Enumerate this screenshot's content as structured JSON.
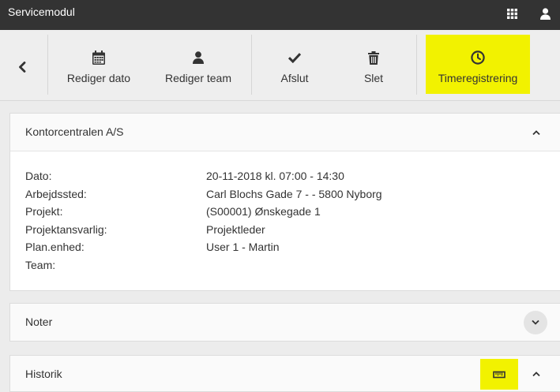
{
  "app": {
    "title": "Servicemodul",
    "apps_icon": "grid-icon",
    "user_icon": "user-icon"
  },
  "toolbar": {
    "back_icon": "chevron-left-icon",
    "actions": [
      {
        "label": "Rediger dato",
        "icon": "calendar-icon"
      },
      {
        "label": "Rediger team",
        "icon": "user-icon"
      },
      {
        "label": "Afslut",
        "icon": "check-icon"
      },
      {
        "label": "Slet",
        "icon": "trash-icon"
      },
      {
        "label": "Timeregistrering",
        "icon": "clock-icon",
        "highlighted": true
      }
    ]
  },
  "details_panel": {
    "title": "Kontorcentralen A/S",
    "expanded": true,
    "toggle_icon": "chevron-up-icon",
    "rows": [
      {
        "label": "Dato:",
        "value": "20-11-2018 kl. 07:00 - 14:30"
      },
      {
        "label": "Arbejdssted:",
        "value": "Carl Blochs Gade 7 - - 5800 Nyborg"
      },
      {
        "label": "Projekt:",
        "value": "(S00001) Ønskegade 1"
      },
      {
        "label": "Projektansvarlig:",
        "value": "Projektleder"
      },
      {
        "label": "Plan.enhed:",
        "value": "User 1 - Martin"
      },
      {
        "label": "Team:",
        "value": ""
      }
    ]
  },
  "notes_panel": {
    "title": "Noter",
    "expanded": false,
    "toggle_icon": "chevron-down-icon"
  },
  "history_panel": {
    "title": "Historik",
    "expanded": true,
    "toggle_icon": "chevron-up-icon",
    "action_icon": "ruler-icon",
    "action_highlighted": true
  },
  "colors": {
    "topbar_bg": "#333333",
    "toolbar_bg": "#eeeeee",
    "page_bg": "#ececec",
    "highlight": "#f2f200",
    "text": "#333333"
  }
}
